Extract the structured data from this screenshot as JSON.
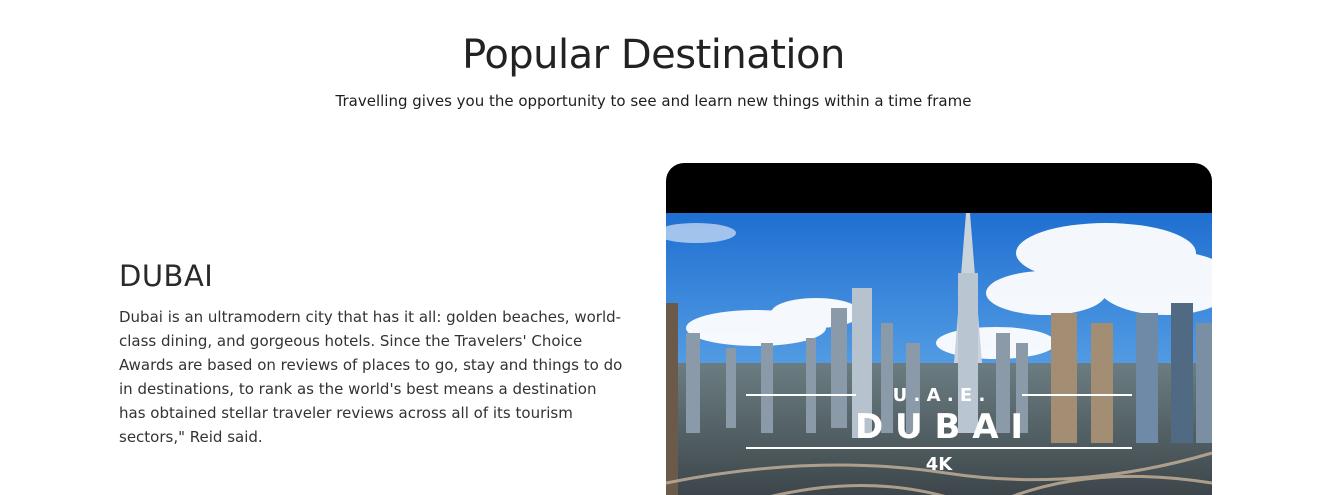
{
  "section": {
    "title": "Popular Destination",
    "subtitle": "Travelling gives you the opportunity to see and learn new things within a time frame"
  },
  "destination": {
    "name": "DUBAI",
    "description": "Dubai is an ultramodern city that has it all: golden beaches, world-class dining, and gorgeous hotels. Since the Travelers' Choice Awards are based on reviews of places to go, stay and things to do in destinations, to rank as the world's best means a destination has obtained stellar traveler reviews across all of its tourism sectors,\" Reid said."
  },
  "media": {
    "overlay_top": "U . A . E .",
    "overlay_main": "D U B A I",
    "overlay_badge": "4K"
  }
}
